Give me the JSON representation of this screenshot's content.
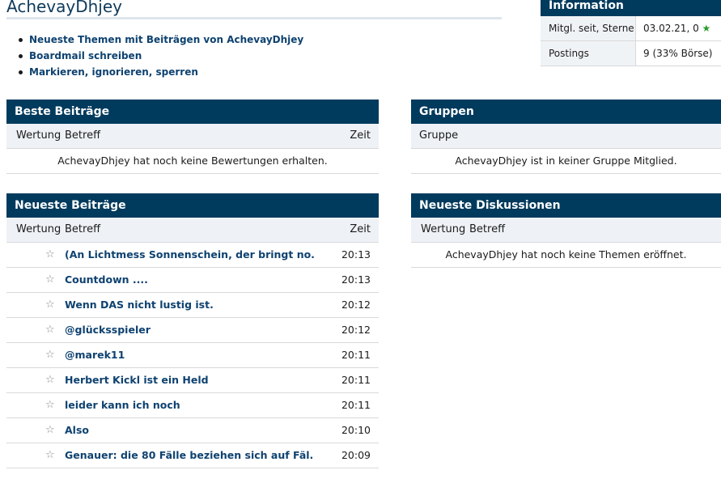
{
  "page": {
    "title": "AchevayDhjey",
    "links": [
      "Neueste Themen mit Beiträgen von AchevayDhjey",
      "Boardmail schreiben",
      "Markieren, ignorieren, sperren"
    ]
  },
  "info": {
    "header": "Information",
    "rows": [
      {
        "label": "Mitgl. seit, Sterne",
        "value": "03.02.21, 0",
        "star": "★"
      },
      {
        "label": "Postings",
        "value": "9 (33% Börse)"
      }
    ]
  },
  "best": {
    "header": "Beste Beiträge",
    "col_rating": "Wertung",
    "col_subject": "Betreff",
    "col_time": "Zeit",
    "empty": "AchevayDhjey hat noch keine Bewertungen erhalten."
  },
  "groups": {
    "header": "Gruppen",
    "col_group": "Gruppe",
    "empty": "AchevayDhjey ist in keiner Gruppe Mitglied."
  },
  "newest_posts": {
    "header": "Neueste Beiträge",
    "col_rating": "Wertung",
    "col_subject": "Betreff",
    "col_time": "Zeit",
    "star_icon": "☆",
    "rows": [
      {
        "subject": "(An Lichtmess Sonnenschein, der bringt no.",
        "time": "20:13"
      },
      {
        "subject": "Countdown ....",
        "time": "20:13"
      },
      {
        "subject": "Wenn DAS nicht lustig ist.",
        "time": "20:12"
      },
      {
        "subject": "@glücksspieler",
        "time": "20:12"
      },
      {
        "subject": "@marek11",
        "time": "20:11"
      },
      {
        "subject": "Herbert Kickl ist ein Held",
        "time": "20:11"
      },
      {
        "subject": "leider kann ich noch",
        "time": "20:11"
      },
      {
        "subject": "Also",
        "time": "20:10"
      },
      {
        "subject": "Genauer: die 80 Fälle beziehen sich auf Fäl.",
        "time": "20:09"
      }
    ]
  },
  "newest_discussions": {
    "header": "Neueste Diskussionen",
    "col_rating": "Wertung",
    "col_subject": "Betreff",
    "empty": "AchevayDhjey hat noch keine Themen eröffnet."
  },
  "colors": {
    "header_bg": "#003a5d",
    "link": "#0e4270",
    "star_green": "#2a9c2a"
  }
}
